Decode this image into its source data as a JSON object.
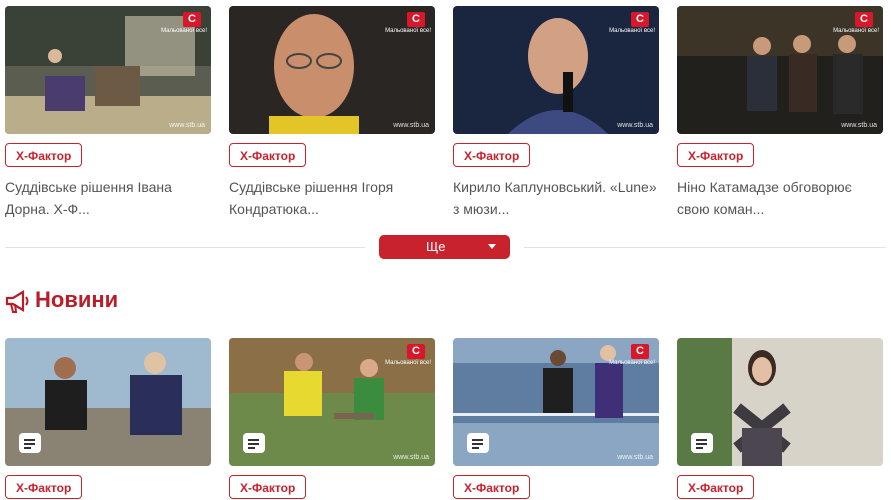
{
  "top_cards": [
    {
      "tag": "Х-Фактор",
      "title": "Суддівське рішення Івана Дорна. Х-Ф...",
      "logo": "С",
      "logo_sub": "Мальованої все!",
      "watermark": "www.stb.ua"
    },
    {
      "tag": "Х-Фактор",
      "title": "Суддівське рішення Ігоря Кондратюка...",
      "logo": "С",
      "logo_sub": "Мальованої все!",
      "watermark": "www.stb.ua"
    },
    {
      "tag": "Х-Фактор",
      "title": "Кирило Каплуновський. «Lune» з мюзи...",
      "logo": "С",
      "logo_sub": "Мальованої все!",
      "watermark": "www.stb.ua"
    },
    {
      "tag": "Х-Фактор",
      "title": "Ніно Катамадзе обговорює свою коман...",
      "logo": "С",
      "logo_sub": "Мальованої все!",
      "watermark": "www.stb.ua"
    }
  ],
  "more_button": {
    "label": "Ще",
    "icon": "caret-down-icon"
  },
  "news": {
    "title": "Новини",
    "icon": "megaphone-icon"
  },
  "news_cards": [
    {
      "tag": "Х-Фактор",
      "icon": "article-icon",
      "logo": "",
      "watermark": ""
    },
    {
      "tag": "Х-Фактор",
      "icon": "article-icon",
      "logo": "С",
      "logo_sub": "Мальованої все!",
      "watermark": "www.stb.ua"
    },
    {
      "tag": "Х-Фактор",
      "icon": "article-icon",
      "logo": "С",
      "logo_sub": "Мальованої все!",
      "watermark": "www.stb.ua"
    },
    {
      "tag": "Х-Фактор",
      "icon": "article-icon",
      "logo": "",
      "watermark": ""
    }
  ],
  "colors": {
    "accent": "#c8232c",
    "heading": "#b81e27",
    "text": "#555555"
  }
}
